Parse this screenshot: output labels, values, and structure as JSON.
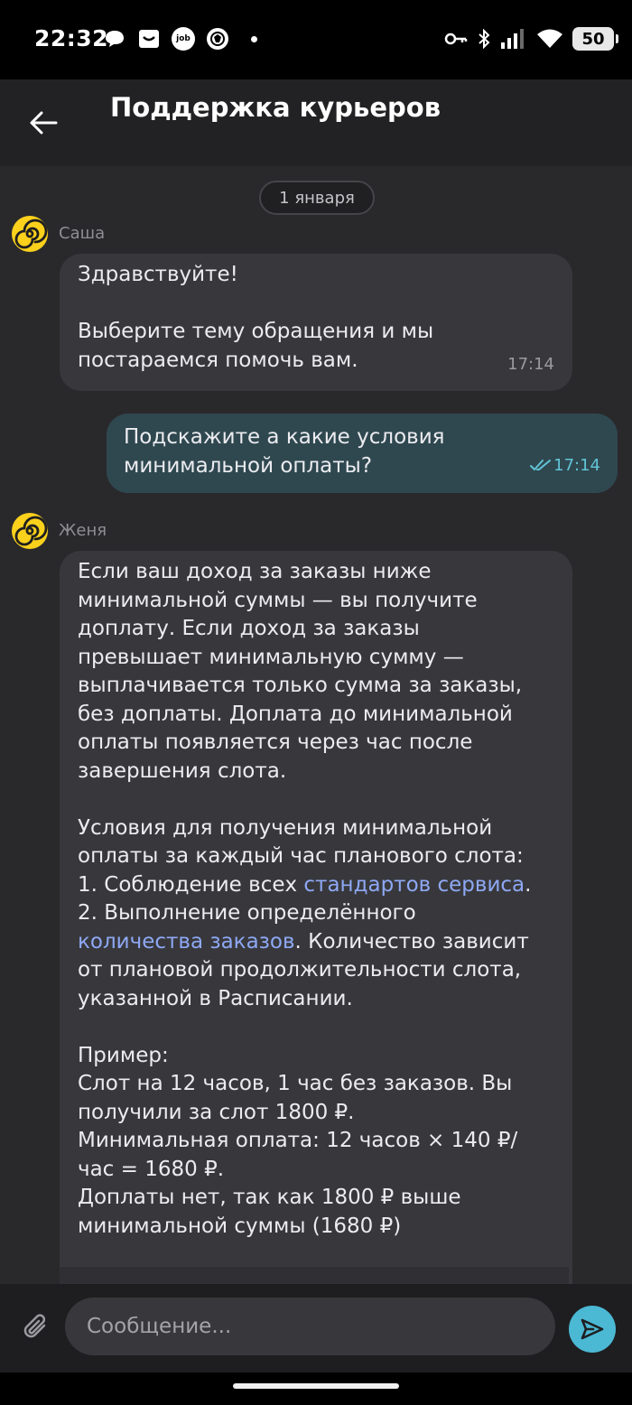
{
  "status_bar": {
    "time": "22:32",
    "left_icons": [
      "chat-bubble-icon",
      "inbox-icon",
      "job-app-icon",
      "emblem-icon",
      "dot-icon"
    ],
    "job_label": "job",
    "right_icons": [
      "key-icon",
      "bluetooth-icon",
      "signal-icon",
      "wifi-icon"
    ],
    "battery": "50"
  },
  "header": {
    "title": "Поддержка курьеров",
    "back_icon": "arrow-left-icon"
  },
  "chat": {
    "date_label": "1 января",
    "messages": [
      {
        "direction": "incoming",
        "author": "Саша",
        "text": "Здравствуйте!\n\nВыберите тему обращения и мы\nпостараемся помочь вам.",
        "time": "17:14"
      },
      {
        "direction": "outgoing",
        "text": "Подскажите а какие условия\nминимальной оплаты?",
        "time": "17:14",
        "status": "read"
      },
      {
        "direction": "incoming",
        "author": "Женя",
        "text_intro": "Если ваш доход за заказы ниже\nминимальной суммы — вы получите\nдоплату. Если доход за заказы\nпревышает минимальную сумму —\nвыплачивается только сумма за заказы,\nбез доплаты. Доплата до минимальной\nоплаты появляется через час после\nзавершения слота.\n\nУсловия для получения минимальной\nоплаты за каждый час планового слота:\n",
        "cond1_prefix": "1. Соблюдение всех ",
        "cond1_link": "стандартов сервиса",
        "cond1_suffix": ".\n2. Выполнение определённого\n",
        "cond2_link": "количества заказов",
        "text_rest": ". Количество зависит\nот плановой продолжительности слота,\nуказанной в Расписании.\n\nПример:\nСлот на 12 часов, 1 час без заказов. Вы\nполучили за слот 1800 ₽.\nМинимальная оплата: 12 часов × 140 ₽/\nчас = 1680 ₽.\nДоплаты нет, так как 1800 ₽ выше\nминимальной суммы (1680 ₽)"
      }
    ]
  },
  "composer": {
    "placeholder": "Сообщение...",
    "attach_icon": "paperclip-icon",
    "send_icon": "send-icon"
  },
  "colors": {
    "accent": "#4bb8d4",
    "avatar": "#fcd11c",
    "link": "#8ea8f4",
    "read_check": "#62c4d6"
  }
}
